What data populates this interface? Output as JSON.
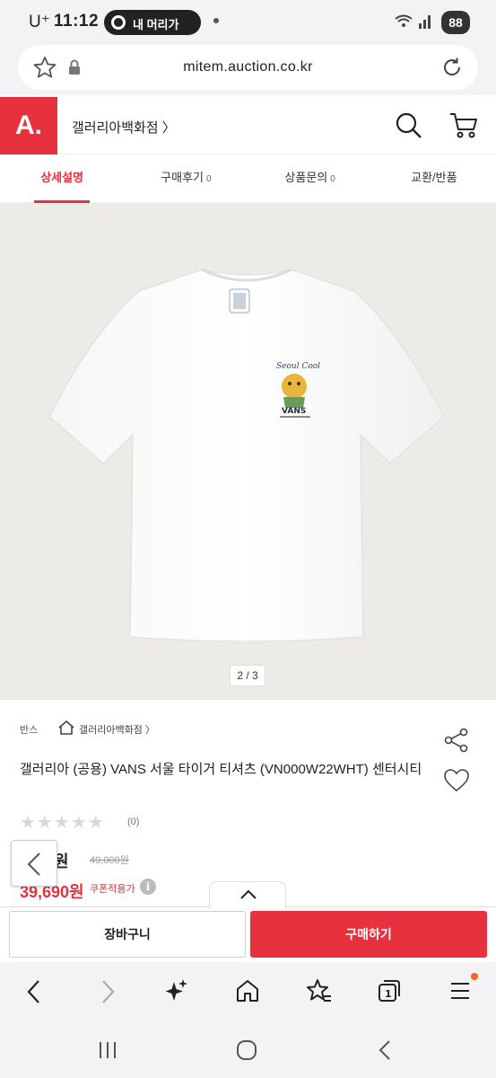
{
  "status_bar": {
    "carrier": "U⁺",
    "time": "11:12",
    "pill_label": "내 머리가",
    "battery": "88"
  },
  "browser": {
    "url": "mitem.auction.co.kr"
  },
  "header": {
    "logo": "A.",
    "store_name": "갤러리아백화점 〉"
  },
  "tabs": [
    {
      "label": "상세설명",
      "count": ""
    },
    {
      "label": "구매후기",
      "count": "0"
    },
    {
      "label": "상품문의",
      "count": "0"
    },
    {
      "label": "교환/반품",
      "count": ""
    }
  ],
  "gallery": {
    "counter": "2 / 3"
  },
  "product": {
    "brand": "반스",
    "shop": "갤러리아백화점 〉",
    "title": "갤러리아 (공용) VANS 서울 타이거 티셔츠 (VN000W22WHT) 센터시티",
    "stars": "★★★★★",
    "review_count": "(0)",
    "price": "00원",
    "original_price": "49,000원",
    "coupon_price": "39,690원",
    "coupon_label": "쿠폰적용가",
    "info_glyph": "i"
  },
  "actions": {
    "cart": "장바구니",
    "buy": "구매하기"
  },
  "colors": {
    "brand_red": "#e8313e",
    "image_bg": "#ecebe7",
    "chrome_bg": "#f3f3f5"
  }
}
